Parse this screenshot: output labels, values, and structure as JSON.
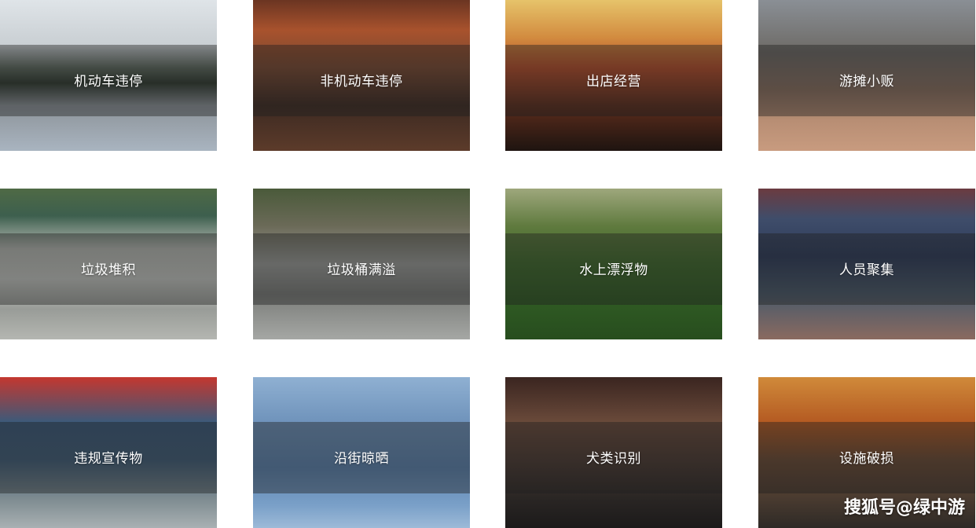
{
  "tiles": [
    {
      "label": "机动车违停"
    },
    {
      "label": "非机动车违停"
    },
    {
      "label": "出店经营"
    },
    {
      "label": "游摊小贩"
    },
    {
      "label": "垃圾堆积"
    },
    {
      "label": "垃圾桶满溢"
    },
    {
      "label": "水上漂浮物"
    },
    {
      "label": "人员聚集"
    },
    {
      "label": "违规宣传物"
    },
    {
      "label": "沿街晾晒"
    },
    {
      "label": "犬类识别"
    },
    {
      "label": "设施破损"
    }
  ],
  "watermark": "搜狐号@绿中游"
}
